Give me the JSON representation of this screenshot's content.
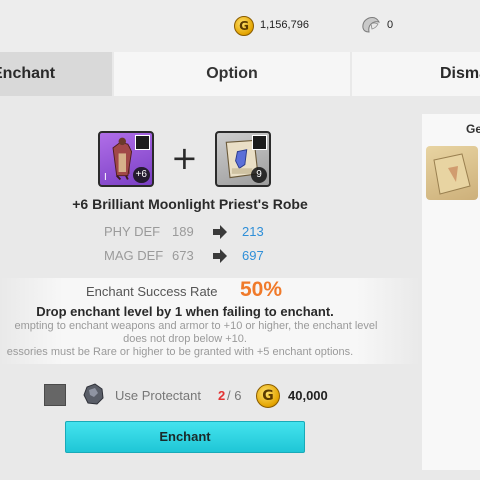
{
  "currency": {
    "gold_icon_glyph": "G",
    "gold_amount": "1,156,796",
    "silver_icon": "silver-ore-icon",
    "silver_amount": "0"
  },
  "tabs": {
    "enchant": "Enchant",
    "option": "Option",
    "dismantle": "Disma"
  },
  "equipment": {
    "icon": "priest-robe-icon",
    "level_label": "I",
    "enchant_badge": "+6",
    "name": "+6 Brilliant Moonlight Priest's Robe"
  },
  "scroll": {
    "icon": "enchant-scroll-icon",
    "count": "9"
  },
  "stats": [
    {
      "label": "PHY DEF",
      "old": "189",
      "new": "213"
    },
    {
      "label": "MAG DEF",
      "old": "673",
      "new": "697"
    }
  ],
  "rate": {
    "label": "Enchant Success Rate",
    "value": "50%",
    "fail_text": "Drop enchant level by 1 when failing to enchant.",
    "note_1": "empting to enchant weapons and armor to +10 or higher, the enchant level",
    "note_2": "does not drop below +10.",
    "note_3": "essories must be Rare or higher to be granted with +5 enchant options."
  },
  "protectant": {
    "label": "Use Protectant",
    "count": "2",
    "max": " / 6",
    "cost_coin_glyph": "G",
    "cost": "40,000"
  },
  "enchant_button": "Enchant",
  "right_panel": {
    "title": "Ge",
    "slot_icon": "scroll-item-icon"
  },
  "colors": {
    "accent_cyan": "#2bd2e0",
    "rate_orange": "#f07a2a",
    "stat_blue": "#2f8fd8",
    "protect_red": "#e23333",
    "equipment_purple": "#9a5ad8"
  }
}
